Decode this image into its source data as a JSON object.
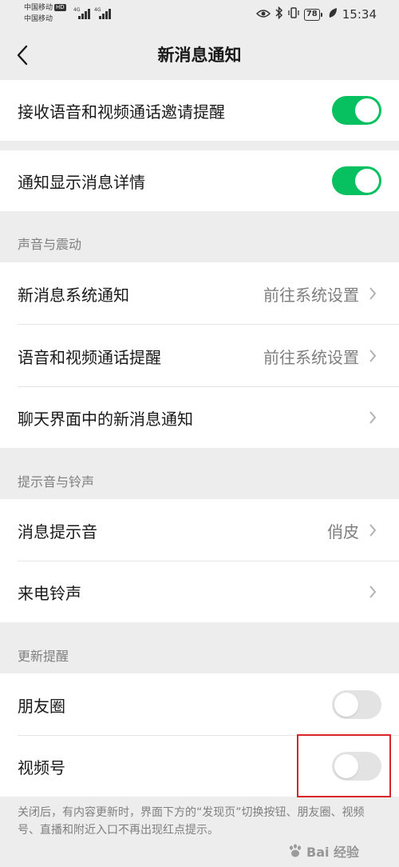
{
  "status_bar": {
    "carrier1": "中国移动",
    "carrier1_badge": "HD",
    "carrier2": "中国移动",
    "network1": "4G",
    "network2": "4G",
    "battery": "78",
    "time": "15:34"
  },
  "nav": {
    "title": "新消息通知",
    "back_icon": "chevron-left-icon"
  },
  "rows": [
    {
      "label": "接收语音和视频通话邀请提醒",
      "toggle": true
    },
    {
      "label": "通知显示消息详情",
      "toggle": true
    }
  ],
  "sections": [
    {
      "header": "声音与震动",
      "items": [
        {
          "label": "新消息系统通知",
          "value": "前往系统设置"
        },
        {
          "label": "语音和视频通话提醒",
          "value": "前往系统设置"
        },
        {
          "label": "聊天界面中的新消息通知",
          "value": ""
        }
      ]
    },
    {
      "header": "提示音与铃声",
      "items": [
        {
          "label": "消息提示音",
          "value": "俏皮"
        },
        {
          "label": "来电铃声",
          "value": ""
        }
      ]
    },
    {
      "header": "更新提醒",
      "items": [
        {
          "label": "朋友圈",
          "toggle": false
        },
        {
          "label": "视频号",
          "toggle": false
        }
      ]
    }
  ],
  "footnote": "关闭后，有内容更新时，界面下方的“发现页”切换按钮、朋友圈、视频号、直播和附近入口不再出现红点提示。",
  "watermark": "Bai 经验",
  "colors": {
    "toggle_on": "#07c160",
    "toggle_off": "#e3e3e3",
    "highlight": "#d9242a",
    "background": "#ededed"
  }
}
